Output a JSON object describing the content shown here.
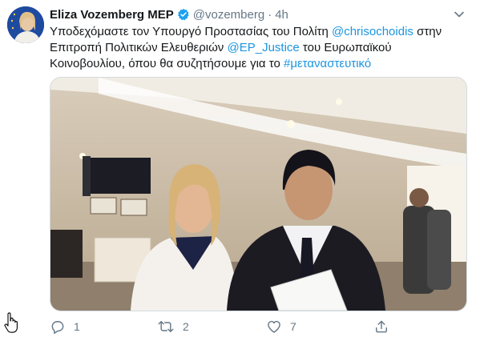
{
  "tweet": {
    "author_name": "Eliza Vozemberg MEP",
    "handle": "@vozemberg",
    "separator": "·",
    "time": "4h",
    "text_line1_a": "Υποδεχόμαστε τον Υπουργό Προστασίας του Πολίτη ",
    "mention1": "@chrisochoidis",
    "text_line1_b": " στην",
    "text_line2_a": "Επιτροπή Πολιτικών Ελευθεριών ",
    "mention2": "@EP_Justice",
    "text_line2_b": " του Ευρωπαϊκού",
    "text_line3_a": "Κοινοβουλίου, όπου θα συζητήσουμε για το ",
    "hashtag": "#μεταναστευτικό"
  },
  "actions": {
    "reply_count": "1",
    "retweet_count": "2",
    "like_count": "7"
  },
  "colors": {
    "link": "#1b95e0",
    "verified": "#1da1f2",
    "muted": "#657786"
  },
  "icons": [
    "verified-badge-icon",
    "chevron-down-icon",
    "reply-icon",
    "retweet-icon",
    "like-icon",
    "share-icon",
    "hand-cursor-icon"
  ]
}
